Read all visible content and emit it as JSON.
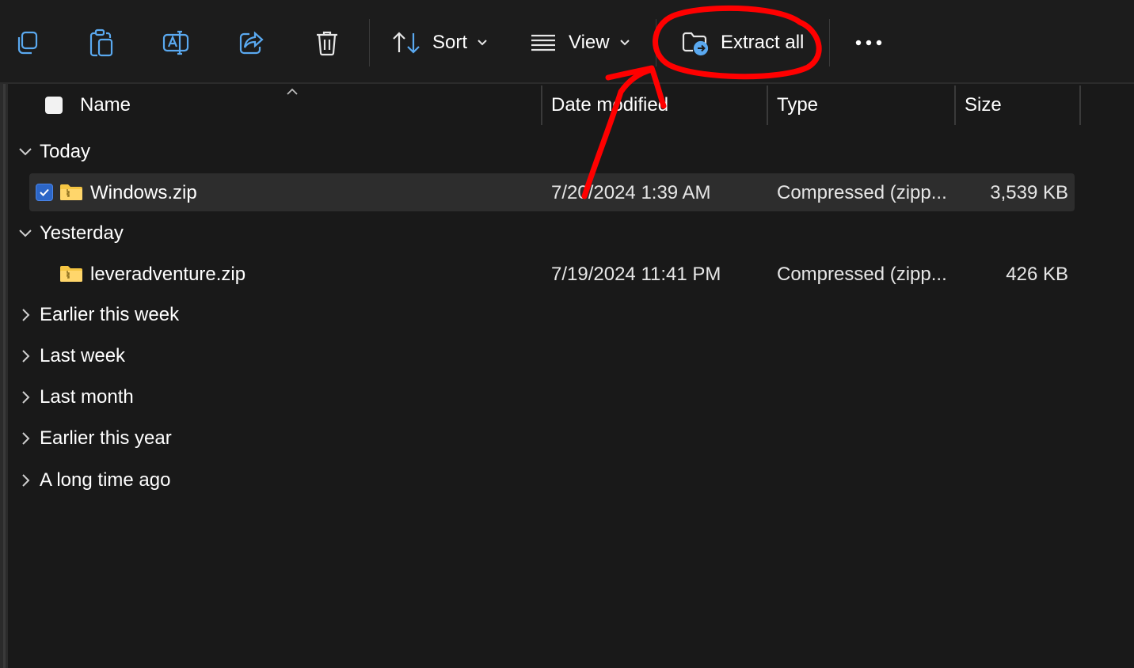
{
  "toolbar": {
    "sort_label": "Sort",
    "view_label": "View",
    "extract_label": "Extract all",
    "icons": [
      "copy-icon",
      "paste-icon",
      "rename-icon",
      "share-icon",
      "delete-icon",
      "sort-icon",
      "view-icon",
      "extract-icon",
      "more-icon"
    ]
  },
  "columns": {
    "name": "Name",
    "date": "Date modified",
    "type": "Type",
    "size": "Size"
  },
  "groups": {
    "today": "Today",
    "yesterday": "Yesterday",
    "earlier_week": "Earlier this week",
    "last_week": "Last week",
    "last_month": "Last month",
    "earlier_year": "Earlier this year",
    "long_ago": "A long time ago"
  },
  "files": [
    {
      "name": "Windows.zip",
      "date": "7/20/2024 1:39 AM",
      "type": "Compressed (zipp...",
      "size": "3,539 KB",
      "selected": true
    },
    {
      "name": "leveradventure.zip",
      "date": "7/19/2024 11:41 PM",
      "type": "Compressed (zipp...",
      "size": "426 KB",
      "selected": false
    }
  ],
  "colors": {
    "background": "#191919",
    "selected_row": "#2d2d2d",
    "checkbox_accent": "#2c66c7",
    "annotation": "#ff0000",
    "folder_yellow": "#f5c542"
  }
}
